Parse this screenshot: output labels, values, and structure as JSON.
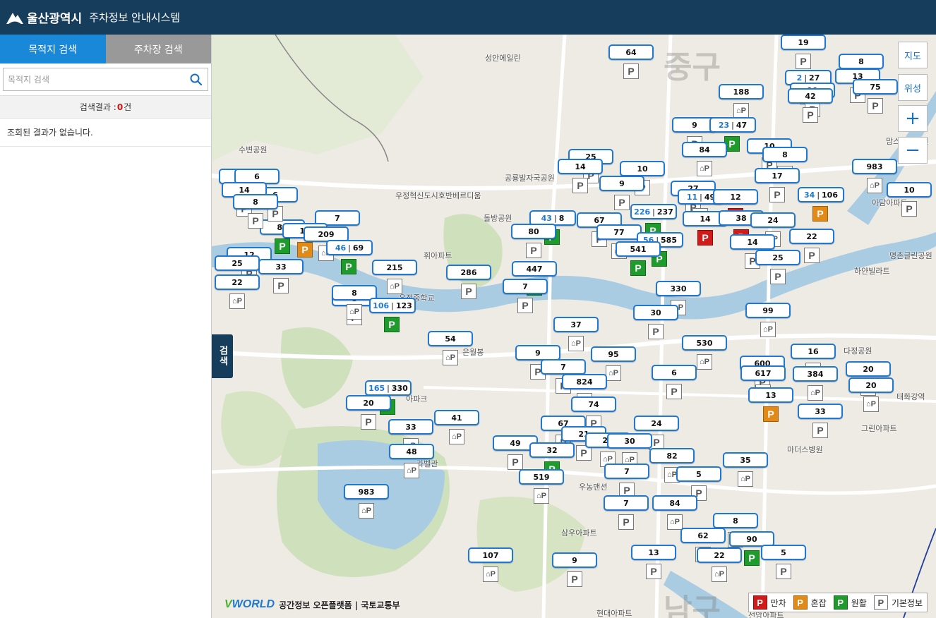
{
  "header": {
    "city": "울산광역시",
    "system": "주차정보 안내시스템"
  },
  "sidebar": {
    "tabs": [
      {
        "label": "목적지 검색",
        "active": true
      },
      {
        "label": "주차장 검색",
        "active": false
      }
    ],
    "search_placeholder": "목적지 검색",
    "result_prefix": "검색결과 : ",
    "result_count": "0",
    "result_suffix": "건",
    "no_result_text": "조회된 결과가 없습니다.",
    "toggle_label": "검색"
  },
  "map_controls": {
    "map_label": "지도",
    "satellite_label": "위성",
    "zoom_in": "+",
    "zoom_out": "−"
  },
  "legend": {
    "items": [
      {
        "glyph": "P",
        "label": "만차",
        "color": "#d11a1a"
      },
      {
        "glyph": "P",
        "label": "혼잡",
        "color": "#e28a17"
      },
      {
        "glyph": "P",
        "label": "원활",
        "color": "#1f9a2d"
      },
      {
        "glyph": "P",
        "label": "기본정보",
        "color": "#ffffff"
      }
    ]
  },
  "attribution": {
    "brand": "WORLD",
    "brand_v": "V",
    "text": "공간정보 오픈플랫폼  |  국토교통부"
  },
  "map_labels": [
    "성안에일린",
    "수변공원",
    "공룡발자국공원",
    "우정혁신도시호반베르디움",
    "돌방공원",
    "휘아파트",
    "맘스여성병원",
    "아담아파트",
    "명촌글린공원",
    "하얀빌라트",
    "우정중학교",
    "은월봉",
    "아파크",
    "라벨관",
    "다정공원",
    "태화강역",
    "마더스병원",
    "그린아파트",
    "우농맨션",
    "삼우아파트",
    "현대아파트",
    "선암아파트",
    "중구",
    "남구"
  ],
  "markers": [
    {
      "count": "64",
      "kind": "basic"
    },
    {
      "count": "19",
      "kind": "basic"
    },
    {
      "count": "8",
      "kind": "basic"
    },
    {
      "count": "2 | 27",
      "kind": "basic"
    },
    {
      "count": "13",
      "kind": "basic"
    },
    {
      "count": "19",
      "kind": "basic"
    },
    {
      "count": "75",
      "kind": "basic"
    },
    {
      "count": "42",
      "kind": "basic"
    },
    {
      "count": "188",
      "kind": "house"
    },
    {
      "count": "9",
      "kind": "basic"
    },
    {
      "count": "23 | 47",
      "kind": "good"
    },
    {
      "count": "84",
      "kind": "house"
    },
    {
      "count": "10",
      "kind": "basic"
    },
    {
      "count": "8",
      "kind": "basic"
    },
    {
      "count": "983",
      "kind": "house"
    },
    {
      "count": "10",
      "kind": "basic"
    },
    {
      "count": "17",
      "kind": "basic"
    },
    {
      "count": "34 | 106",
      "kind": "mid"
    },
    {
      "count": "25",
      "kind": "basic"
    },
    {
      "count": "14",
      "kind": "basic"
    },
    {
      "count": "10",
      "kind": "basic"
    },
    {
      "count": "9",
      "kind": "basic"
    },
    {
      "count": "27",
      "kind": "basic"
    },
    {
      "count": "11 | 49",
      "kind": "basic"
    },
    {
      "count": "12",
      "kind": "full"
    },
    {
      "count": "226 | 237",
      "kind": "good"
    },
    {
      "count": "14",
      "kind": "full"
    },
    {
      "count": "38",
      "kind": "full"
    },
    {
      "count": "24",
      "kind": "house"
    },
    {
      "count": "22",
      "kind": "basic"
    },
    {
      "count": "14",
      "kind": "basic"
    },
    {
      "count": "43 | 8",
      "kind": "good"
    },
    {
      "count": "80",
      "kind": "basic"
    },
    {
      "count": "67",
      "kind": "basic"
    },
    {
      "count": "77",
      "kind": "house"
    },
    {
      "count": "56 | 585",
      "kind": "good"
    },
    {
      "count": "541",
      "kind": "good"
    },
    {
      "count": "25",
      "kind": "basic"
    },
    {
      "count": "7",
      "kind": "basic"
    },
    {
      "count": "81",
      "kind": "good"
    },
    {
      "count": "18",
      "kind": "mid"
    },
    {
      "count": "209",
      "kind": "house"
    },
    {
      "count": "46 | 69",
      "kind": "good"
    },
    {
      "count": "6",
      "kind": "basic"
    },
    {
      "count": "6",
      "kind": "basic"
    },
    {
      "count": "6",
      "kind": "basic"
    },
    {
      "count": "14",
      "kind": "basic"
    },
    {
      "count": "8",
      "kind": "basic"
    },
    {
      "count": "12",
      "kind": "basic"
    },
    {
      "count": "25",
      "kind": "basic"
    },
    {
      "count": "33",
      "kind": "basic"
    },
    {
      "count": "22",
      "kind": "house"
    },
    {
      "count": "215",
      "kind": "house"
    },
    {
      "count": "286",
      "kind": "basic"
    },
    {
      "count": "447",
      "kind": "good"
    },
    {
      "count": "7",
      "kind": "basic"
    },
    {
      "count": "8",
      "kind": "basic"
    },
    {
      "count": "8",
      "kind": "house"
    },
    {
      "count": "106 | 123",
      "kind": "good"
    },
    {
      "count": "330",
      "kind": "house"
    },
    {
      "count": "30",
      "kind": "basic"
    },
    {
      "count": "99",
      "kind": "house"
    },
    {
      "count": "37",
      "kind": "house"
    },
    {
      "count": "54",
      "kind": "house"
    },
    {
      "count": "530",
      "kind": "house"
    },
    {
      "count": "9",
      "kind": "basic"
    },
    {
      "count": "95",
      "kind": "house"
    },
    {
      "count": "16",
      "kind": "basic"
    },
    {
      "count": "600",
      "kind": "basic"
    },
    {
      "count": "617",
      "kind": "basic"
    },
    {
      "count": "384",
      "kind": "house"
    },
    {
      "count": "20",
      "kind": "basic"
    },
    {
      "count": "20",
      "kind": "house"
    },
    {
      "count": "6",
      "kind": "basic"
    },
    {
      "count": "7",
      "kind": "basic"
    },
    {
      "count": "824",
      "kind": "house"
    },
    {
      "count": "165 | 330",
      "kind": "good"
    },
    {
      "count": "13",
      "kind": "mid"
    },
    {
      "count": "74",
      "kind": "basic"
    },
    {
      "count": "20",
      "kind": "basic"
    },
    {
      "count": "33",
      "kind": "house"
    },
    {
      "count": "41",
      "kind": "house"
    },
    {
      "count": "33",
      "kind": "basic"
    },
    {
      "count": "67",
      "kind": "basic"
    },
    {
      "count": "21",
      "kind": "basic"
    },
    {
      "count": "24",
      "kind": "basic"
    },
    {
      "count": "48",
      "kind": "house"
    },
    {
      "count": "49",
      "kind": "basic"
    },
    {
      "count": "32",
      "kind": "good"
    },
    {
      "count": "20",
      "kind": "house"
    },
    {
      "count": "30",
      "kind": "house"
    },
    {
      "count": "82",
      "kind": "house"
    },
    {
      "count": "5",
      "kind": "basic"
    },
    {
      "count": "35",
      "kind": "house"
    },
    {
      "count": "519",
      "kind": "house"
    },
    {
      "count": "7",
      "kind": "basic"
    },
    {
      "count": "983",
      "kind": "house"
    },
    {
      "count": "7",
      "kind": "basic"
    },
    {
      "count": "84",
      "kind": "house"
    },
    {
      "count": "8",
      "kind": "basic"
    },
    {
      "count": "62",
      "kind": "basic"
    },
    {
      "count": "90",
      "kind": "good"
    },
    {
      "count": "13",
      "kind": "basic"
    },
    {
      "count": "22",
      "kind": "house"
    },
    {
      "count": "5",
      "kind": "basic"
    },
    {
      "count": "107",
      "kind": "house"
    },
    {
      "count": "9",
      "kind": "basic"
    }
  ]
}
